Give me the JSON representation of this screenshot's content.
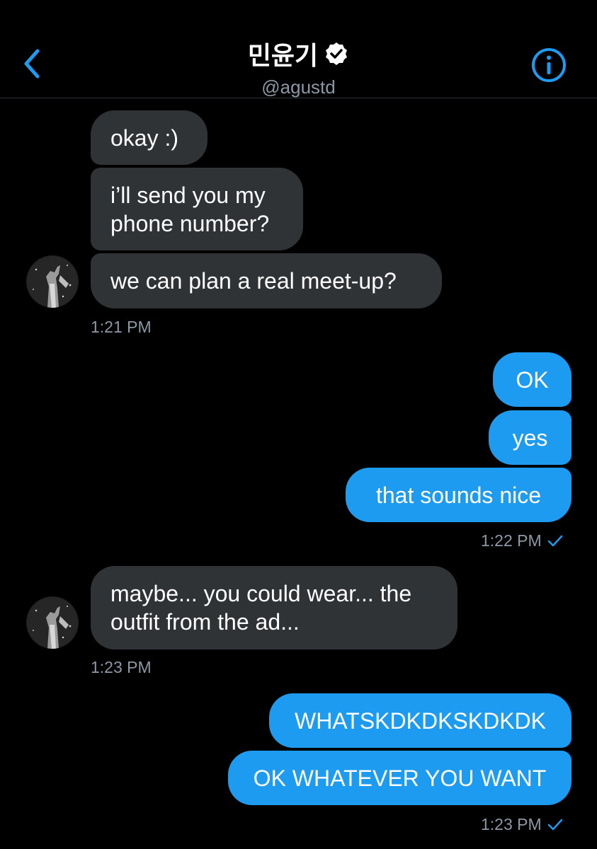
{
  "header": {
    "title": "민윤기",
    "handle": "@agustd",
    "back_icon": "chevron-left-icon",
    "info_icon": "info-icon",
    "verified_icon": "verified-badge-icon",
    "accent": "#1d9bf0"
  },
  "messages": {
    "group1": [
      "okay :)",
      "i’ll send you my phone number?",
      "we can plan a real meet-up?"
    ],
    "group1_line1": "i’ll send you my",
    "group1_line2": "phone number?",
    "time1": "1:21 PM",
    "out1": [
      "OK",
      "yes",
      "that sounds nice"
    ],
    "time2": "1:22 PM",
    "in2_line1": "maybe... you could wear... the",
    "in2_line2": "outfit from the ad...",
    "time3": "1:23 PM",
    "out2": [
      "WHATSKDKDKSKDKDK",
      "OK WHATEVER YOU WANT"
    ],
    "time4": "1:23 PM"
  },
  "colors": {
    "incoming_bubble": "#2f3336",
    "outgoing_bubble": "#1d9bf0",
    "timestamp": "#8b98a5"
  }
}
